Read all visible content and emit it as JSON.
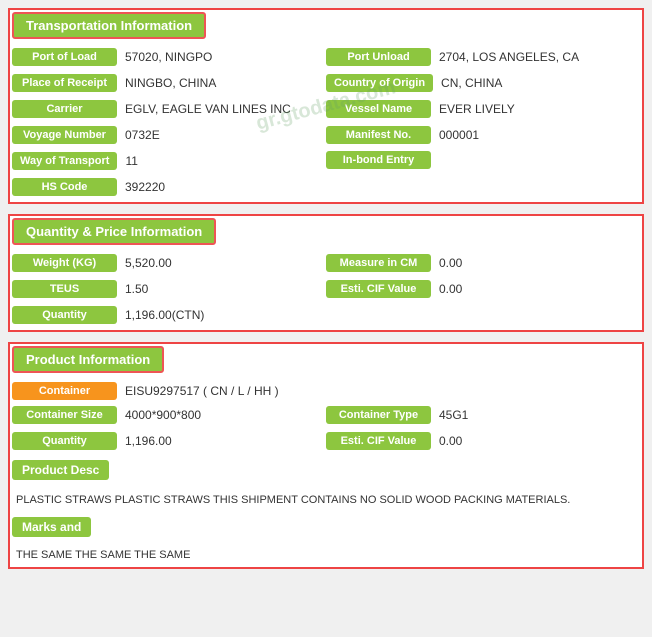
{
  "sections": {
    "transportation": {
      "title": "Transportation Information",
      "fields_left": [
        {
          "label": "Port of Load",
          "value": "57020, NINGPO"
        },
        {
          "label": "Place of Receipt",
          "value": "NINGBO, CHINA"
        },
        {
          "label": "Carrier",
          "value": "EGLV, EAGLE VAN LINES INC"
        },
        {
          "label": "Voyage Number",
          "value": "0732E"
        },
        {
          "label": "Way of Transport",
          "value": "11"
        },
        {
          "label": "HS Code",
          "value": "392220"
        }
      ],
      "fields_right": [
        {
          "label": "Port Unload",
          "value": "2704, LOS ANGELES, CA"
        },
        {
          "label": "Country of Origin",
          "value": "CN, CHINA"
        },
        {
          "label": "Vessel Name",
          "value": "EVER LIVELY"
        },
        {
          "label": "Manifest No.",
          "value": "000001"
        },
        {
          "label": "In-bond Entry",
          "value": ""
        },
        {
          "label": "",
          "value": ""
        }
      ]
    },
    "quantity": {
      "title": "Quantity & Price Information",
      "fields_left": [
        {
          "label": "Weight (KG)",
          "value": "5,520.00"
        },
        {
          "label": "TEUS",
          "value": "1.50"
        },
        {
          "label": "Quantity",
          "value": "1,196.00(CTN)"
        }
      ],
      "fields_right": [
        {
          "label": "Measure in CM",
          "value": "0.00"
        },
        {
          "label": "Esti. CIF Value",
          "value": "0.00"
        },
        {
          "label": "",
          "value": ""
        }
      ]
    },
    "product": {
      "title": "Product Information",
      "container_label": "Container",
      "container_value": "EISU9297517 ( CN / L / HH )",
      "fields_left": [
        {
          "label": "Container Size",
          "value": "4000*900*800"
        },
        {
          "label": "Quantity",
          "value": "1,196.00"
        }
      ],
      "fields_right": [
        {
          "label": "Container Type",
          "value": "45G1"
        },
        {
          "label": "Esti. CIF Value",
          "value": "0.00"
        }
      ],
      "product_desc_label": "Product Desc",
      "product_desc_text": "PLASTIC STRAWS PLASTIC STRAWS THIS SHIPMENT CONTAINS NO SOLID WOOD PACKING MATERIALS.",
      "marks_label": "Marks and",
      "marks_text": "THE SAME THE SAME THE SAME"
    }
  },
  "watermark": "gr.gtodata.com"
}
